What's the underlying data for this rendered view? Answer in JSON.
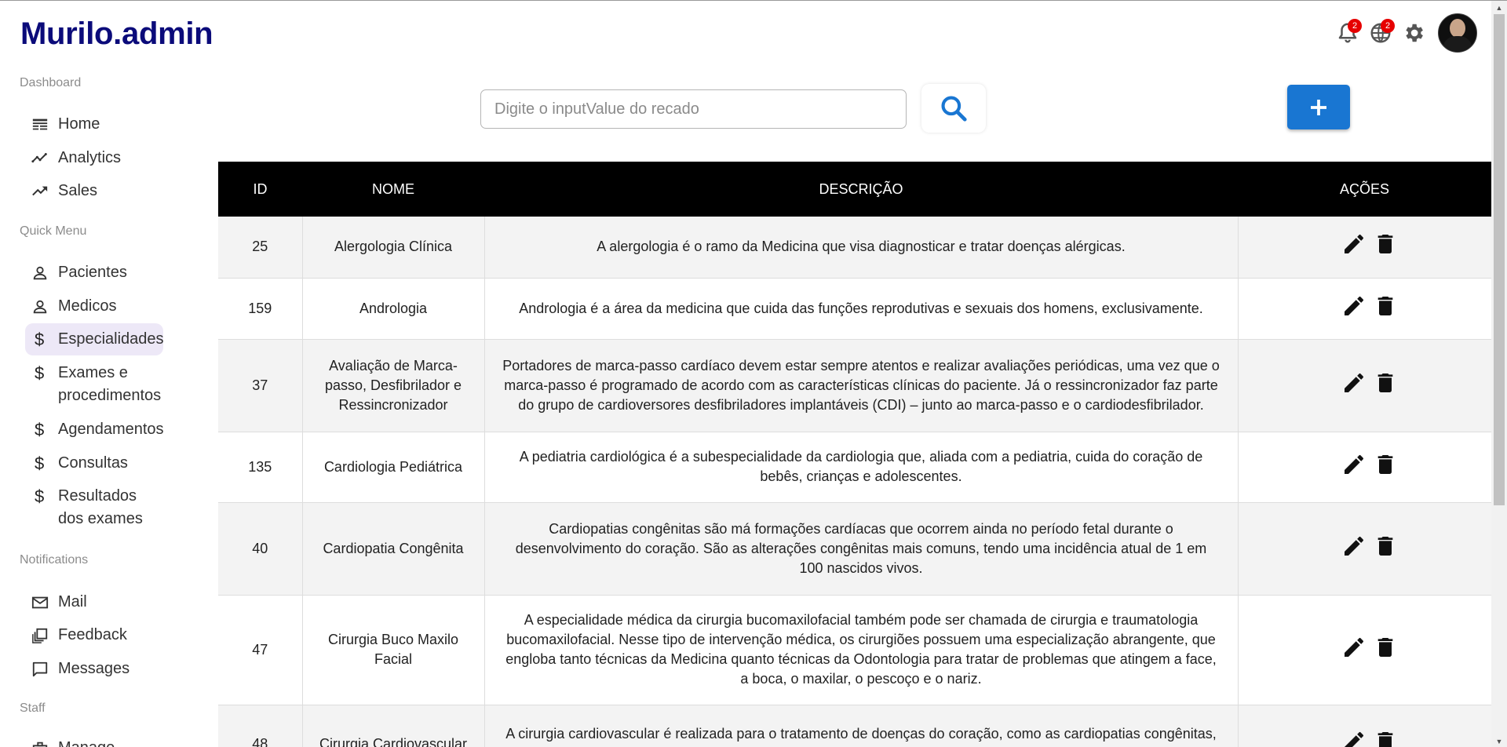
{
  "brand": {
    "title": "Murilo.admin"
  },
  "sidebar": {
    "sections": [
      {
        "title": "Dashboard"
      },
      {
        "title": "Quick Menu"
      },
      {
        "title": "Notifications"
      },
      {
        "title": "Staff"
      }
    ],
    "items": [
      {
        "label": "Home",
        "icon": "dashboard-icon"
      },
      {
        "label": "Analytics",
        "icon": "timeline-icon"
      },
      {
        "label": "Sales",
        "icon": "trending-up-icon"
      },
      {
        "label": "Pacientes",
        "icon": "person-icon"
      },
      {
        "label": "Medicos",
        "icon": "person-icon"
      },
      {
        "label": "Especialidades",
        "icon": "dollar-icon",
        "active": true
      },
      {
        "label": "Exames e procedimentos",
        "icon": "dollar-icon"
      },
      {
        "label": "Agendamentos",
        "icon": "dollar-icon"
      },
      {
        "label": "Consultas",
        "icon": "dollar-icon"
      },
      {
        "label": "Resultados dos exames",
        "icon": "dollar-icon"
      },
      {
        "label": "Mail",
        "icon": "mail-icon"
      },
      {
        "label": "Feedback",
        "icon": "feedback-icon"
      },
      {
        "label": "Messages",
        "icon": "chat-icon"
      },
      {
        "label": "Manage",
        "icon": "work-icon"
      }
    ]
  },
  "topbar": {
    "notifications_badge": "2",
    "language_badge": "2",
    "icons": [
      "bell-icon",
      "globe-icon",
      "settings-icon",
      "avatar"
    ]
  },
  "search": {
    "placeholder": "Digite o inputValue do recado",
    "value": ""
  },
  "table": {
    "headers": [
      "ID",
      "NOME",
      "DESCRIÇÃO",
      "AÇÕES"
    ],
    "rows": [
      {
        "id": "25",
        "nome": "Alergologia Clínica",
        "descricao": "A alergologia é o ramo da Medicina que visa diagnosticar e tratar doenças alérgicas."
      },
      {
        "id": "159",
        "nome": "Andrologia",
        "descricao": "Andrologia é a área da medicina que cuida das funções reprodutivas e sexuais dos homens, exclusivamente."
      },
      {
        "id": "37",
        "nome": "Avaliação de Marca-passo, Desfibrilador e Ressincronizador",
        "descricao": "Portadores de marca-passo cardíaco devem estar sempre atentos e realizar avaliações periódicas, uma vez que o marca-passo é programado de acordo com as características clínicas do paciente. Já o ressincronizador faz parte do grupo de cardioversores desfibriladores implantáveis (CDI) – junto ao marca-passo e o cardiodesfibrilador."
      },
      {
        "id": "135",
        "nome": "Cardiologia Pediátrica",
        "descricao": "A pediatria cardiológica é a subespecialidade da cardiologia que, aliada com a pediatria, cuida do coração de bebês, crianças e adolescentes."
      },
      {
        "id": "40",
        "nome": "Cardiopatia Congênita",
        "descricao": "Cardiopatias congênitas são má formações cardíacas que ocorrem ainda no período fetal durante o desenvolvimento do coração. São as alterações congênitas mais comuns, tendo uma incidência atual de 1 em 100 nascidos vivos."
      },
      {
        "id": "47",
        "nome": "Cirurgia Buco Maxilo Facial",
        "descricao": "A especialidade médica da cirurgia bucomaxilofacial também pode ser chamada de cirurgia e traumatologia bucomaxilofacial. Nesse tipo de intervenção médica, os cirurgiões possuem uma especialização abrangente, que engloba tanto técnicas da Medicina quanto técnicas da Odontologia para tratar de problemas que atingem a face, a boca, o maxilar, o pescoço e o nariz."
      },
      {
        "id": "48",
        "nome": "Cirurgia Cardiovascular",
        "descricao": "A cirurgia cardiovascular é realizada para o tratamento de doenças do coração, como as cardiopatias congênitas, doenças das válvulas cardíacas, doenças da aorta e arritmias, como a fibrilação atrial, e insuficiência cardíaca."
      }
    ]
  }
}
